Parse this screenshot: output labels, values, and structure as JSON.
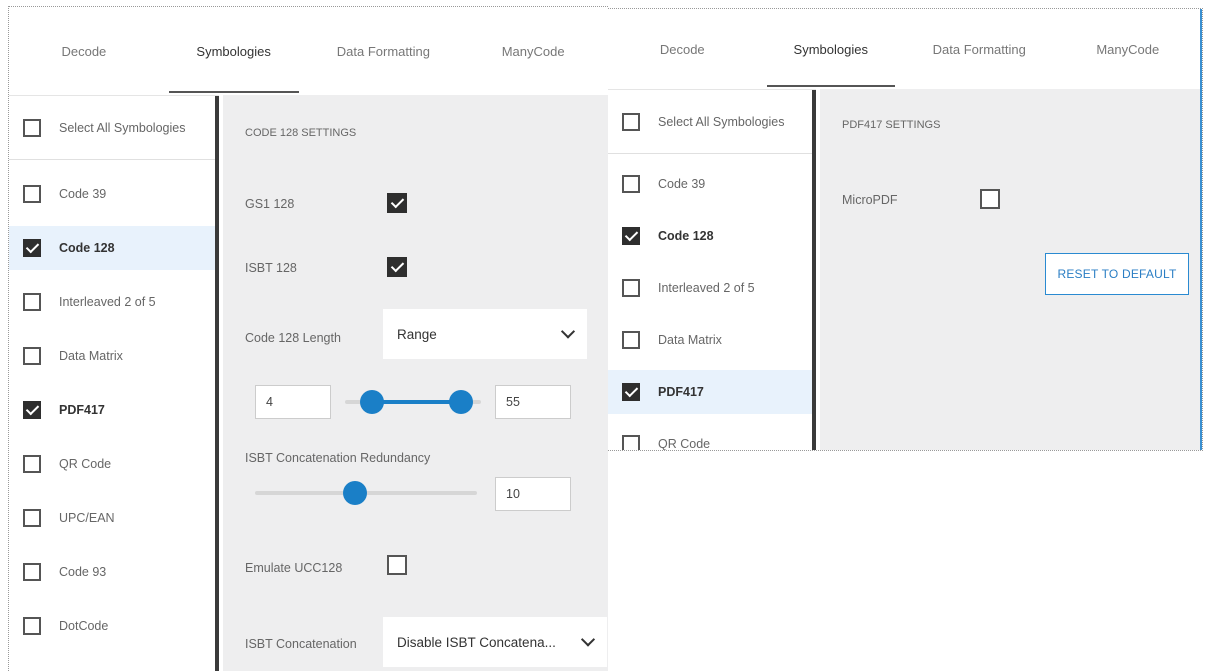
{
  "left": {
    "tabs": [
      {
        "label": "Decode",
        "active": false
      },
      {
        "label": "Symbologies",
        "active": true
      },
      {
        "label": "Data Formatting",
        "active": false
      },
      {
        "label": "ManyCode",
        "active": false
      }
    ],
    "select_all_label": "Select All Symbologies",
    "symbologies": [
      {
        "label": "Code 39",
        "checked": false
      },
      {
        "label": "Code 128",
        "checked": true,
        "selected": true
      },
      {
        "label": "Interleaved 2 of 5",
        "checked": false
      },
      {
        "label": "Data Matrix",
        "checked": false
      },
      {
        "label": "PDF417",
        "checked": true
      },
      {
        "label": "QR Code",
        "checked": false
      },
      {
        "label": "UPC/EAN",
        "checked": false
      },
      {
        "label": "Code 93",
        "checked": false
      },
      {
        "label": "DotCode",
        "checked": false
      }
    ],
    "settings": {
      "title": "CODE 128 SETTINGS",
      "gs1_label": "GS1 128",
      "gs1_checked": true,
      "isbt_label": "ISBT 128",
      "isbt_checked": true,
      "length_label": "Code 128 Length",
      "length_value": "Range",
      "range_min": "4",
      "range_max": "55",
      "range_low_fraction": 0.2,
      "range_high_fraction": 0.85,
      "redundancy_label": "ISBT Concatenation Redundancy",
      "redundancy_value": "10",
      "redundancy_fraction": 0.45,
      "emulate_label": "Emulate UCC128",
      "emulate_checked": false,
      "concat_label": "ISBT Concatenation",
      "concat_value": "Disable ISBT Concatena..."
    }
  },
  "right": {
    "tabs": [
      {
        "label": "Decode",
        "active": false
      },
      {
        "label": "Symbologies",
        "active": true
      },
      {
        "label": "Data Formatting",
        "active": false
      },
      {
        "label": "ManyCode",
        "active": false
      }
    ],
    "select_all_label": "Select All Symbologies",
    "symbologies": [
      {
        "label": "Code 39",
        "checked": false
      },
      {
        "label": "Code 128",
        "checked": true
      },
      {
        "label": "Interleaved 2 of 5",
        "checked": false
      },
      {
        "label": "Data Matrix",
        "checked": false
      },
      {
        "label": "PDF417",
        "checked": true,
        "selected": true
      },
      {
        "label": "QR Code",
        "checked": false
      }
    ],
    "settings": {
      "title": "PDF417 SETTINGS",
      "micro_label": "MicroPDF",
      "micro_checked": false,
      "reset_label": "RESET TO DEFAULT"
    }
  },
  "colors": {
    "accent": "#1a7fc7",
    "selected_row": "#e8f2fc",
    "settings_bg": "#eeeeef",
    "divider": "#3a3a3a"
  }
}
